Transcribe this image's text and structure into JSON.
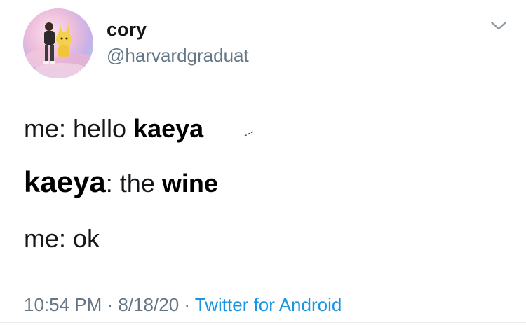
{
  "author": {
    "display_name": "cory",
    "handle": "@harvardgraduat",
    "avatar_icon": "avatar-photo"
  },
  "menu_icon": "chevron-down-icon",
  "tweet_lines": [
    {
      "prefix": "me: hello ",
      "emphasis": "kaeya"
    },
    {
      "speaker": "kaeya",
      "middle": ": the ",
      "emphasis": "wine"
    },
    {
      "text": "me: ok"
    }
  ],
  "meta": {
    "time": "10:54 PM",
    "separator": " · ",
    "date": "8/18/20",
    "source": "Twitter for Android"
  },
  "colors": {
    "text_primary": "#14171a",
    "text_secondary": "#657786",
    "link": "#1b95e0",
    "background": "#ffffff"
  }
}
